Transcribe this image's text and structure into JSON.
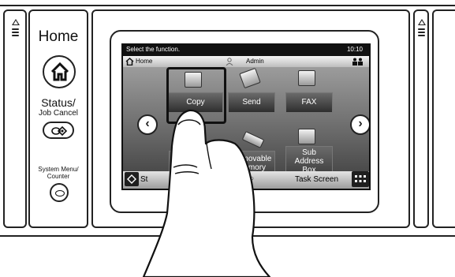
{
  "hardware": {
    "home_label": "Home",
    "status_label_line1": "Status/",
    "status_label_line2": "Job Cancel",
    "system_menu_line1": "System Menu/",
    "system_menu_line2": "Counter"
  },
  "screen": {
    "message": "Select the function.",
    "time": "10:10",
    "nav": {
      "home_tab": "Home",
      "user": "Admin"
    },
    "functions": [
      {
        "label": "Copy",
        "icon": "copy-icon",
        "selected": true
      },
      {
        "label": "Send",
        "icon": "send-icon"
      },
      {
        "label": "FAX",
        "icon": "fax-icon"
      },
      {
        "label": "Removable\nMemory",
        "icon": "usb-icon"
      },
      {
        "label": "Sub\nAddress\nBox",
        "icon": "address-box-icon"
      }
    ],
    "bottom": {
      "status": "St",
      "task": "Task Screen"
    },
    "page_dots": "●○"
  }
}
